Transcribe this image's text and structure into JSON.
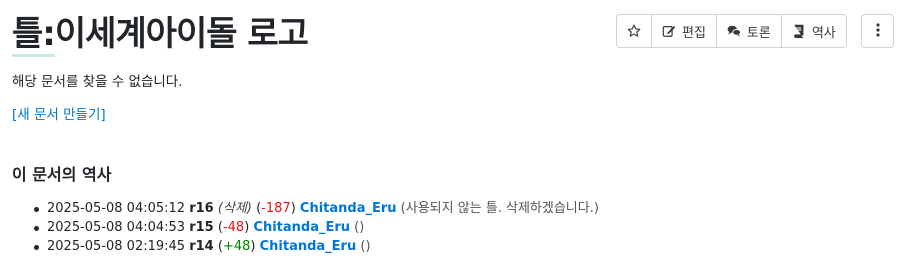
{
  "page": {
    "title_ns": "틀:",
    "title_name": "이세계아이돌 로고",
    "notice": "해당 문서를 찾을 수 없습니다.",
    "new_doc_link": "[새 문서 만들기]",
    "history_heading": "이 문서의 역사"
  },
  "toolbar": {
    "star_icon": "star-icon",
    "edit_label": "편집",
    "discuss_label": "토론",
    "history_label": "역사",
    "more_icon": "vertical-ellipsis-icon"
  },
  "history": [
    {
      "timestamp": "2025-05-08 04:05:12",
      "rev": "r16",
      "action": "(삭제)",
      "change_open": "(",
      "change": "-187",
      "change_close": ")",
      "user": "Chitanda_Eru",
      "summary": "(사용되지 않는 틀. 삭제하겠습니다.)"
    },
    {
      "timestamp": "2025-05-08 04:04:53",
      "rev": "r15",
      "action": "",
      "change_open": "(",
      "change": "-48",
      "change_close": ")",
      "user": "Chitanda_Eru",
      "summary": "()"
    },
    {
      "timestamp": "2025-05-08 02:19:45",
      "rev": "r14",
      "action": "",
      "change_open": "(",
      "change": "+48",
      "change_close": ")",
      "user": "Chitanda_Eru",
      "summary": "()"
    }
  ],
  "colors": {
    "link": "#0275d8",
    "negative_change": "#e11111",
    "positive_change": "#008800"
  }
}
